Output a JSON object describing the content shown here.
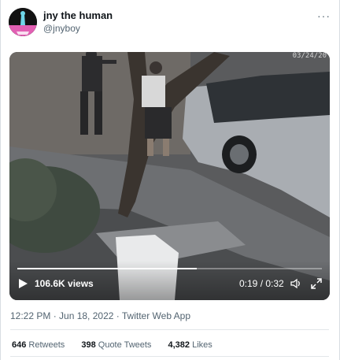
{
  "author": {
    "display_name": "jny the human",
    "handle": "@jnyboy",
    "avatar_icon": "avatar-image"
  },
  "menu": {
    "more_label": "···"
  },
  "video": {
    "timestamp_overlay": "03/24/20",
    "views_label": "106.6K views",
    "time_label": "0:19 / 0:32",
    "progress_fraction": 0.59,
    "play_icon": "play-icon",
    "volume_icon": "volume-icon",
    "fullscreen_icon": "fullscreen-icon"
  },
  "tweet_meta": {
    "line": "12:22 PM · Jun 18, 2022 · Twitter Web App"
  },
  "stats": {
    "retweets_count": "646",
    "retweets_label": "Retweets",
    "quote_count": "398",
    "quote_label": "Quote Tweets",
    "likes_count": "4,382",
    "likes_label": "Likes"
  },
  "colors": {
    "text_primary": "#0f1419",
    "text_secondary": "#536471",
    "divider": "#e3e7ea"
  }
}
